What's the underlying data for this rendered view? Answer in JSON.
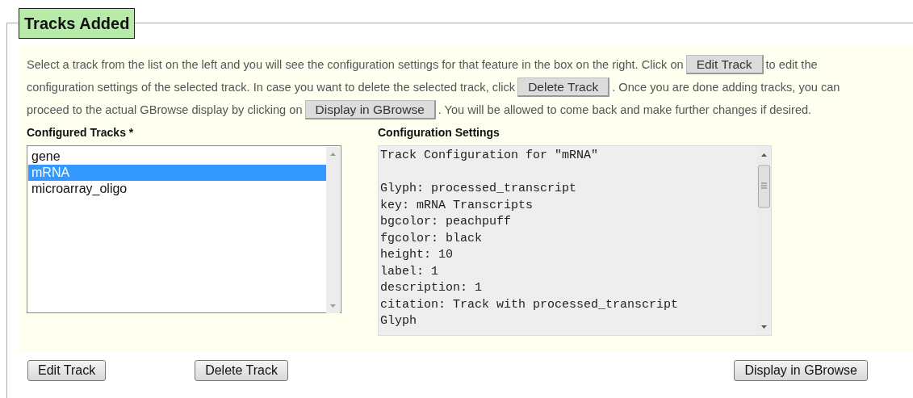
{
  "section": {
    "title": "Tracks Added"
  },
  "intro": [
    [
      {
        "kind": "text",
        "text": "Select a track from the list on the left and you will see the configuration settings for that feature in the box on the right. Click on"
      },
      {
        "kind": "button",
        "text": "Edit Track"
      },
      {
        "kind": "text",
        "text": "to edit the"
      }
    ],
    [
      {
        "kind": "text",
        "text": "configuration settings of the selected track. In case you want to delete the selected track, click"
      },
      {
        "kind": "button",
        "text": "Delete Track"
      },
      {
        "kind": "text",
        "text": ". Once you are done adding tracks, you can"
      }
    ],
    [
      {
        "kind": "text",
        "text": "proceed to the actual GBrowse display by clicking on"
      },
      {
        "kind": "button",
        "text": "Display in GBrowse"
      },
      {
        "kind": "text",
        "text": ". You will be allowed to come back and make further changes if desired."
      }
    ]
  ],
  "tracks": {
    "label": "Configured Tracks *",
    "items": [
      {
        "name": "gene",
        "selected": false
      },
      {
        "name": "mRNA",
        "selected": true
      },
      {
        "name": "microarray_oligo",
        "selected": false
      }
    ]
  },
  "config": {
    "label": "Configuration Settings",
    "text": "Track Configuration for \"mRNA\"\n\nGlyph: processed_transcript\nkey: mRNA Transcripts\nbgcolor: peachpuff\nfgcolor: black\nheight: 10\nlabel: 1\ndescription: 1\ncitation: Track with processed_transcript\nGlyph"
  },
  "buttons": [
    "Edit Track",
    "Delete Track",
    "Display in GBrowse"
  ]
}
